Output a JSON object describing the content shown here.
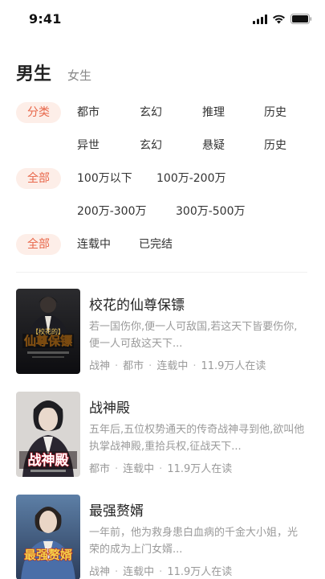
{
  "status_bar": {
    "time": "9:41"
  },
  "gender_tabs": [
    {
      "label": "男生",
      "active": true
    },
    {
      "label": "女生",
      "active": false
    }
  ],
  "filters": {
    "category": {
      "pill": "分类",
      "options": [
        "都市",
        "玄幻",
        "推理",
        "历史",
        "异世",
        "玄幻",
        "悬疑",
        "历史"
      ]
    },
    "word_count": {
      "pill": "全部",
      "options": [
        "100万以下",
        "100万-200万",
        "200万-300万",
        "300万-500万"
      ]
    },
    "status": {
      "pill": "全部",
      "options": [
        "连载中",
        "已完结"
      ]
    }
  },
  "books": [
    {
      "title": "校花的仙尊保镖",
      "desc": "若一国伤你,便一人可敌国,若这天下皆要伤你,便一人可敌这天下...",
      "tags": [
        "战神",
        "都市",
        "连载中",
        "11.9万人在读"
      ],
      "cover_text": "仙尊保镖",
      "cover_sub": "【校花的】"
    },
    {
      "title": "战神殿",
      "desc": "五年后,五位权势通天的传奇战神寻到他,欲叫他执掌战神殿,重拾兵权,征战天下...",
      "tags": [
        "都市",
        "连载中",
        "11.9万人在读"
      ],
      "cover_text": "战神殿",
      "cover_sub": ""
    },
    {
      "title": "最强赘婿",
      "desc": "一年前，他为救身患白血病的千金大小姐，光荣的成为上门女婿...",
      "tags": [
        "战神",
        "连载中",
        "11.9万人在读"
      ],
      "cover_text": "最强赘婿",
      "cover_sub": ""
    }
  ],
  "colors": {
    "accent": "#e8674a",
    "pill_bg": "#fdeee8",
    "muted": "#9a9a9a"
  }
}
